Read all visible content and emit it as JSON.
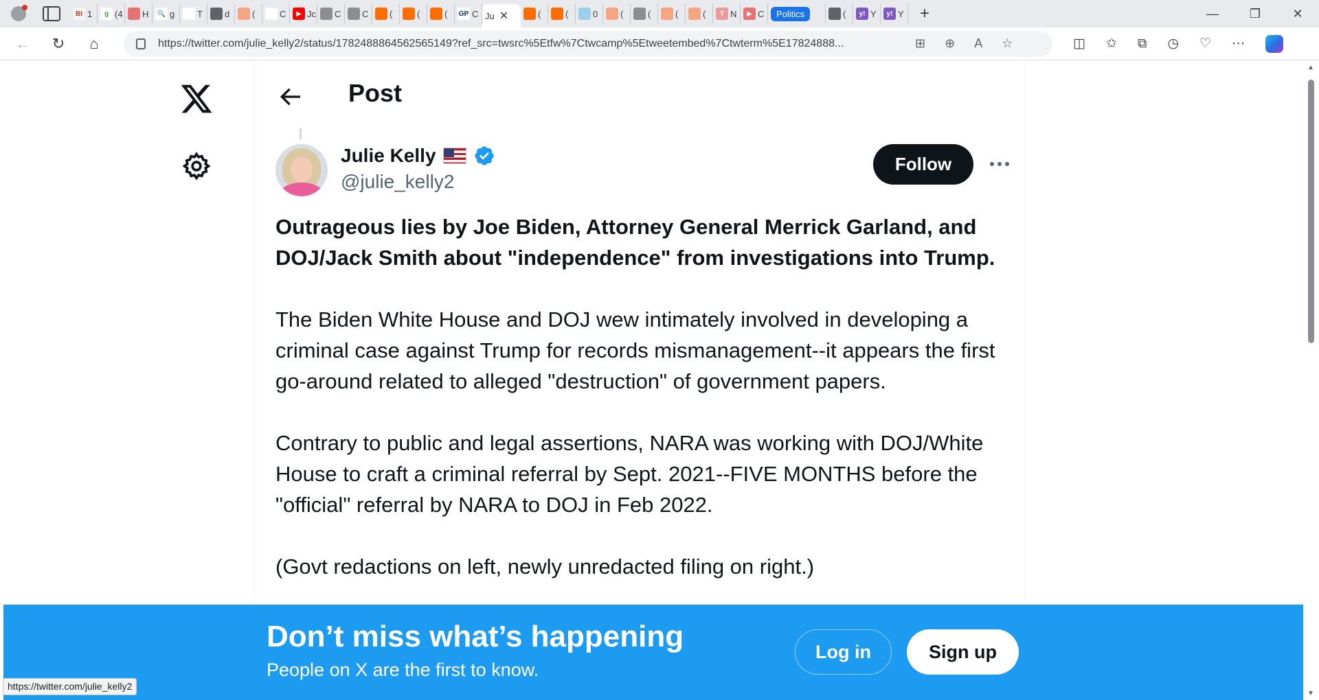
{
  "browser": {
    "tabs": [
      {
        "label": "1",
        "fav": "BI",
        "color": "#f3f3f3",
        "fg": "#c0392b"
      },
      {
        "label": "(4",
        "fav": "g",
        "color": "#ffffff",
        "fg": "#43a047"
      },
      {
        "label": "H",
        "fav": "",
        "color": "#e57373",
        "fg": "#ffffff"
      },
      {
        "label": "g",
        "fav": "🔍",
        "color": "#ffffff",
        "fg": "#5f6368"
      },
      {
        "label": "T",
        "fav": "",
        "color": "#ffffff",
        "fg": "#5f6368"
      },
      {
        "label": "d",
        "fav": "",
        "color": "#5f6368",
        "fg": "#ffffff"
      },
      {
        "label": "(",
        "fav": "",
        "color": "#f4a582",
        "fg": "#ffffff"
      },
      {
        "label": "C",
        "fav": "",
        "color": "#ffffff",
        "fg": "#5f6368"
      },
      {
        "label": "Jc",
        "fav": "▶",
        "color": "#ff0000",
        "fg": "#ffffff"
      },
      {
        "label": "C",
        "fav": "",
        "color": "#8d8d8d",
        "fg": "#ffffff"
      },
      {
        "label": "C",
        "fav": "",
        "color": "#8d8d8d",
        "fg": "#ffffff"
      },
      {
        "label": "(",
        "fav": "",
        "color": "#ff6d00",
        "fg": "#ffffff"
      },
      {
        "label": "(",
        "fav": "",
        "color": "#ff6d00",
        "fg": "#ffffff"
      },
      {
        "label": "(",
        "fav": "",
        "color": "#ff6d00",
        "fg": "#ffffff"
      },
      {
        "label": "C",
        "fav": "GP",
        "color": "#ffffff",
        "fg": "#0b2e6b"
      }
    ],
    "active_tab": {
      "label": "Ju",
      "close": "✕"
    },
    "tabs_after": [
      {
        "label": "(",
        "fav": "",
        "color": "#ff6d00",
        "fg": "#ffffff"
      },
      {
        "label": "(",
        "fav": "",
        "color": "#ff6d00",
        "fg": "#ffffff"
      },
      {
        "label": "0",
        "fav": "",
        "color": "#9ad0e8",
        "fg": "#ffffff"
      },
      {
        "label": "(",
        "fav": "",
        "color": "#f4a582",
        "fg": "#ffffff"
      },
      {
        "label": "(",
        "fav": "",
        "color": "#8d8d8d",
        "fg": "#ffffff"
      },
      {
        "label": "(",
        "fav": "",
        "color": "#f4a582",
        "fg": "#ffffff"
      },
      {
        "label": "(",
        "fav": "",
        "color": "#f4a582",
        "fg": "#ffffff"
      },
      {
        "label": "N",
        "fav": "T",
        "color": "#ef9a9a",
        "fg": "#ffffff"
      },
      {
        "label": "C",
        "fav": "▶",
        "color": "#e57373",
        "fg": "#ffffff"
      }
    ],
    "chip_tab": "Politics",
    "tabs_tail": [
      {
        "label": "(",
        "fav": "",
        "color": "#5f6368",
        "fg": "#ffffff"
      },
      {
        "label": "Y",
        "fav": "y!",
        "color": "#7e57c2",
        "fg": "#ffffff"
      },
      {
        "label": "Y",
        "fav": "y!",
        "color": "#7e57c2",
        "fg": "#ffffff"
      }
    ],
    "new_tab": "+",
    "url": "https://twitter.com/julie_kelly2/status/1782488864562565149?ref_src=twsrc%5Etfw%7Ctwcamp%5Etweetembed%7Ctwterm%5E17824888...",
    "status_url": "https://twitter.com/julie_kelly2"
  },
  "header": {
    "title": "Post"
  },
  "tweet": {
    "author_name": "Julie Kelly",
    "author_handle": "@julie_kelly2",
    "follow_label": "Follow",
    "paragraphs": [
      "Outrageous lies by Joe Biden, Attorney General Merrick Garland, and DOJ/Jack Smith about \"independence\" from investigations into Trump.",
      "The Biden White House and DOJ wew intimately involved in developing a criminal case against Trump for records mismanagement--it appears the first go-around related to alleged \"destruction\" of government papers.",
      "Contrary to public and legal assertions, NARA was working with DOJ/White House to craft a criminal referral by Sept. 2021--FIVE MONTHS before the \"official\" referral by NARA to DOJ in Feb 2022.",
      "(Govt redactions on left, newly unredacted filing on right.)"
    ]
  },
  "banner": {
    "title": "Don’t miss what’s happening",
    "subtitle": "People on X are the first to know.",
    "login_label": "Log in",
    "signup_label": "Sign up",
    "color": "#1d9bf0"
  }
}
